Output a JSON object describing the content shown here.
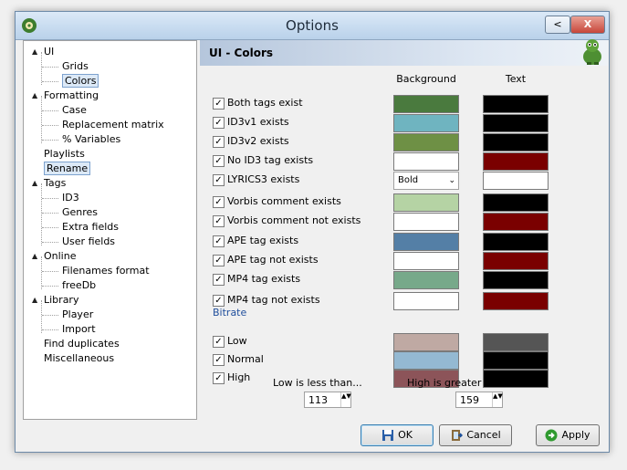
{
  "window": {
    "title": "Options",
    "help_label": "<",
    "close_label": "X"
  },
  "tree": {
    "items": [
      {
        "label": "UI",
        "expander": "▲"
      },
      {
        "label": "Grids"
      },
      {
        "label": "Colors"
      },
      {
        "label": "Formatting",
        "expander": "▲"
      },
      {
        "label": "Case"
      },
      {
        "label": "Replacement matrix"
      },
      {
        "label": "% Variables"
      },
      {
        "label": "Playlists"
      },
      {
        "label": "Rename"
      },
      {
        "label": "Tags",
        "expander": "▲"
      },
      {
        "label": "ID3"
      },
      {
        "label": "Genres"
      },
      {
        "label": "Extra fields"
      },
      {
        "label": "User fields"
      },
      {
        "label": "Online",
        "expander": "▲"
      },
      {
        "label": "Filenames format"
      },
      {
        "label": "freeDb"
      },
      {
        "label": "Library",
        "expander": "▲"
      },
      {
        "label": "Player"
      },
      {
        "label": "Import"
      },
      {
        "label": "Find duplicates"
      },
      {
        "label": "Miscellaneous"
      }
    ]
  },
  "panel": {
    "title": "UI - Colors",
    "col_background": "Background",
    "col_text": "Text",
    "rows": [
      {
        "label": "Both tags exist",
        "checked": true,
        "bg": "#4a7a3e",
        "fg": "#000000"
      },
      {
        "label": "ID3v1 exists",
        "checked": true,
        "bg": "#6fb4c0",
        "fg": "#000000"
      },
      {
        "label": "ID3v2 exists",
        "checked": true,
        "bg": "#6e9045",
        "fg": "#000000"
      },
      {
        "label": "No ID3 tag exists",
        "checked": true,
        "bg": "#ffffff",
        "fg": "#7a0000"
      },
      {
        "label": "LYRICS3 exists",
        "checked": true,
        "select_value": "Bold",
        "fg": "#ffffff"
      },
      {
        "label": "Vorbis comment exists",
        "checked": true,
        "bg": "#b5d3a4",
        "fg": "#000000"
      },
      {
        "label": "Vorbis comment not exists",
        "checked": true,
        "bg": "#ffffff",
        "fg": "#7a0000"
      },
      {
        "label": "APE tag exists",
        "checked": true,
        "bg": "#547fa6",
        "fg": "#000000"
      },
      {
        "label": "APE tag not exists",
        "checked": true,
        "bg": "#ffffff",
        "fg": "#7a0000"
      },
      {
        "label": "MP4 tag exists",
        "checked": true,
        "bg": "#77a98a",
        "fg": "#000000"
      },
      {
        "label": "MP4 tag not exists",
        "checked": true,
        "bg": "#ffffff",
        "fg": "#7a0000"
      }
    ],
    "bitrate_title": "Bitrate",
    "bitrate_rows": [
      {
        "label": "Low",
        "checked": true,
        "bg": "#bfa9a3",
        "fg": "#555555"
      },
      {
        "label": "Normal",
        "checked": true,
        "bg": "#94b9d2",
        "fg": "#000000"
      },
      {
        "label": "High",
        "checked": true,
        "bg": "#8c5459",
        "fg": "#000000"
      }
    ],
    "low_label": "Low is less than...",
    "low_value": "113",
    "high_label": "High is greater than...",
    "high_value": "159"
  },
  "buttons": {
    "ok": "OK",
    "cancel": "Cancel",
    "apply": "Apply"
  },
  "check_mark": "✓",
  "spin_arrows": "▲▼",
  "colors": {
    "accent": "#1f4e9c",
    "selection": "#dce9f7"
  }
}
